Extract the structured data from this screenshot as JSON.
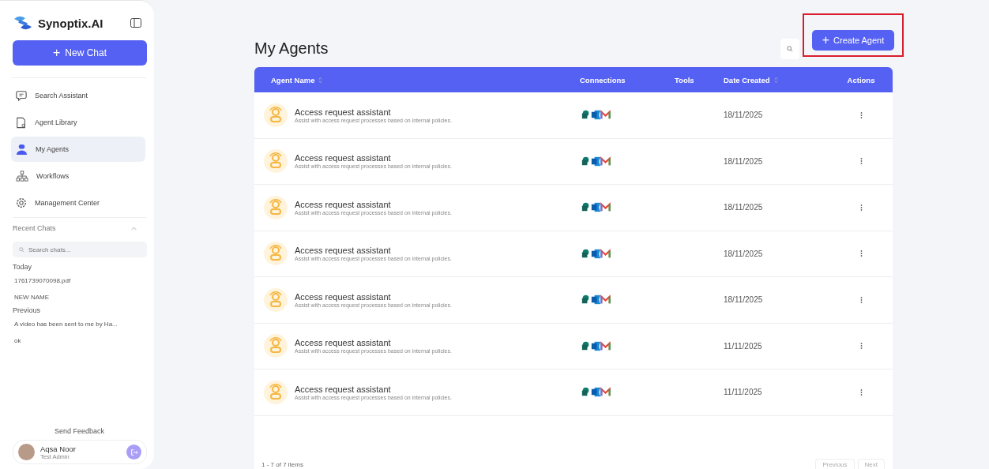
{
  "brand": {
    "name": "Synoptix.AI"
  },
  "new_chat": {
    "icon": "+",
    "label": "New Chat"
  },
  "nav": [
    {
      "label": "Search Assistant",
      "selected": false
    },
    {
      "label": "Agent Library",
      "selected": false
    },
    {
      "label": "My Agents",
      "selected": true
    },
    {
      "label": "Workflows",
      "selected": false
    },
    {
      "label": "Management Center",
      "selected": false
    }
  ],
  "recent": {
    "title": "Recent Chats",
    "expanded": true,
    "search_placeholder": "Search chats...",
    "groups": [
      {
        "label": "Today",
        "items": [
          "1761739070098.pdf",
          "NEW NAME"
        ]
      },
      {
        "label": "Previous",
        "items": [
          "A video has been sent to me by Ha...",
          "ok"
        ]
      }
    ]
  },
  "feedback": "Send Feedback",
  "user": {
    "name": "Aqsa Noor",
    "role": "Test Admin"
  },
  "page": {
    "title": "My Agents",
    "create_icon": "+",
    "create_label": "Create Agent"
  },
  "table": {
    "columns": [
      {
        "label": "Agent Name",
        "sortable": true
      },
      {
        "label": "Connections",
        "sortable": false
      },
      {
        "label": "Tools",
        "sortable": false
      },
      {
        "label": "Date Created",
        "sortable": true
      },
      {
        "label": "Actions",
        "sortable": false
      }
    ],
    "rows": [
      {
        "name": "Access request assistant",
        "description": "Assist with access request processes based on internal policies.",
        "date": "18/11/2025"
      },
      {
        "name": "Access request assistant",
        "description": "Assist with access request processes based on internal policies.",
        "date": "18/11/2025"
      },
      {
        "name": "Access request assistant",
        "description": "Assist with access request processes based on internal policies.",
        "date": "18/11/2025"
      },
      {
        "name": "Access request assistant",
        "description": "Assist with access request processes based on internal policies.",
        "date": "18/11/2025"
      },
      {
        "name": "Access request assistant",
        "description": "Assist with access request processes based on internal policies.",
        "date": "18/11/2025"
      },
      {
        "name": "Access request assistant",
        "description": "Assist with access request processes based on internal policies.",
        "date": "11/11/2025"
      },
      {
        "name": "Access request assistant",
        "description": "Assist with access request processes based on internal policies.",
        "date": "11/11/2025"
      }
    ],
    "summary": "1 - 7 of 7 items",
    "pagination": [
      "Previous",
      "Next"
    ]
  }
}
